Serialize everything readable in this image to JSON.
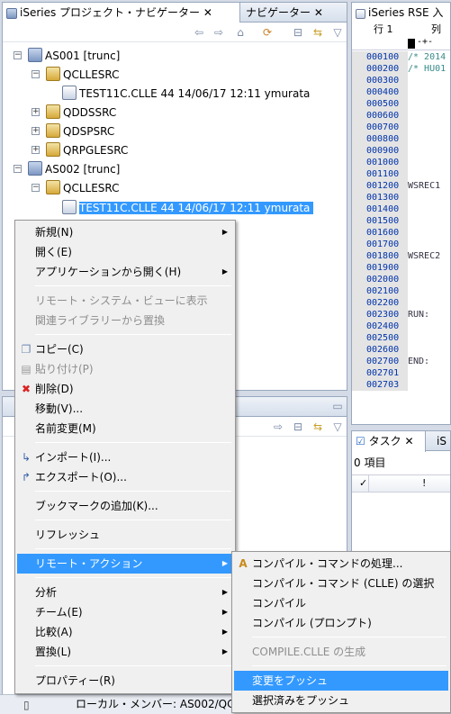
{
  "left_view": {
    "tabs": [
      "iSeries プロジェクト・ナビゲーター",
      "ナビゲーター"
    ],
    "tree": [
      {
        "label": "AS001 [trunc]"
      },
      {
        "label": "QCLLESRC"
      },
      {
        "label": "TEST11C.CLLE 44  14/06/17 12:11  ymurata"
      },
      {
        "label": "QDDSSRC"
      },
      {
        "label": "QDSPSRC"
      },
      {
        "label": "QRPGLESRC"
      },
      {
        "label": "AS002 [trunc]"
      },
      {
        "label": "QCLLESRC"
      },
      {
        "label": "TEST11C.CLLE 44  14/06/17 12:11  ymurata"
      }
    ]
  },
  "editor": {
    "tab": "iSeries RSE 入",
    "ruler_row": "行 1",
    "ruler_col": "列",
    "ruler_marks": "-+-",
    "lines": [
      "000100",
      "000200",
      "000300",
      "000400",
      "000500",
      "000600",
      "000700",
      "000800",
      "000900",
      "001000",
      "001100",
      "001200",
      "001300",
      "001400",
      "001500",
      "001600",
      "001700",
      "001800",
      "001900",
      "002000",
      "002100",
      "002200",
      "002300",
      "002400",
      "002500",
      "002600",
      "002700",
      "002701",
      "002703"
    ],
    "code": {
      "000100": "/* 2014",
      "000200": "/* HU01",
      "001200": "WSREC1",
      "001800": "WSREC2",
      "002300": "RUN:",
      "002700": "END:"
    }
  },
  "tasks": {
    "tab": "タスク",
    "tab2": "iS",
    "count": "0 項目",
    "col1": "✓",
    "col2": "!"
  },
  "status": {
    "text": "ローカル・メンバー: AS002/QC"
  },
  "context_menu": {
    "items": [
      {
        "label": "新規(N)"
      },
      {
        "label": "開く(E)"
      },
      {
        "label": "アプリケーションから開く(H)"
      },
      {
        "label": "リモート・システム・ビューに表示"
      },
      {
        "label": "関連ライブラリーから置換"
      },
      {
        "label": "コピー(C)"
      },
      {
        "label": "貼り付け(P)"
      },
      {
        "label": "削除(D)"
      },
      {
        "label": "移動(V)..."
      },
      {
        "label": "名前変更(M)"
      },
      {
        "label": "インポート(I)..."
      },
      {
        "label": "エクスポート(O)..."
      },
      {
        "label": "ブックマークの追加(K)..."
      },
      {
        "label": "リフレッシュ"
      },
      {
        "label": "リモート・アクション"
      },
      {
        "label": "分析"
      },
      {
        "label": "チーム(E)"
      },
      {
        "label": "比較(A)"
      },
      {
        "label": "置換(L)"
      },
      {
        "label": "プロパティー(R)"
      }
    ]
  },
  "submenu": {
    "items": [
      {
        "label": "コンパイル・コマンドの処理..."
      },
      {
        "label": "コンパイル・コマンド (CLLE) の選択"
      },
      {
        "label": "コンパイル"
      },
      {
        "label": "コンパイル (プロンプト)"
      },
      {
        "label": "COMPILE.CLLE の生成"
      },
      {
        "label": "変更をプッシュ"
      },
      {
        "label": "選択済みをプッシュ"
      }
    ]
  }
}
